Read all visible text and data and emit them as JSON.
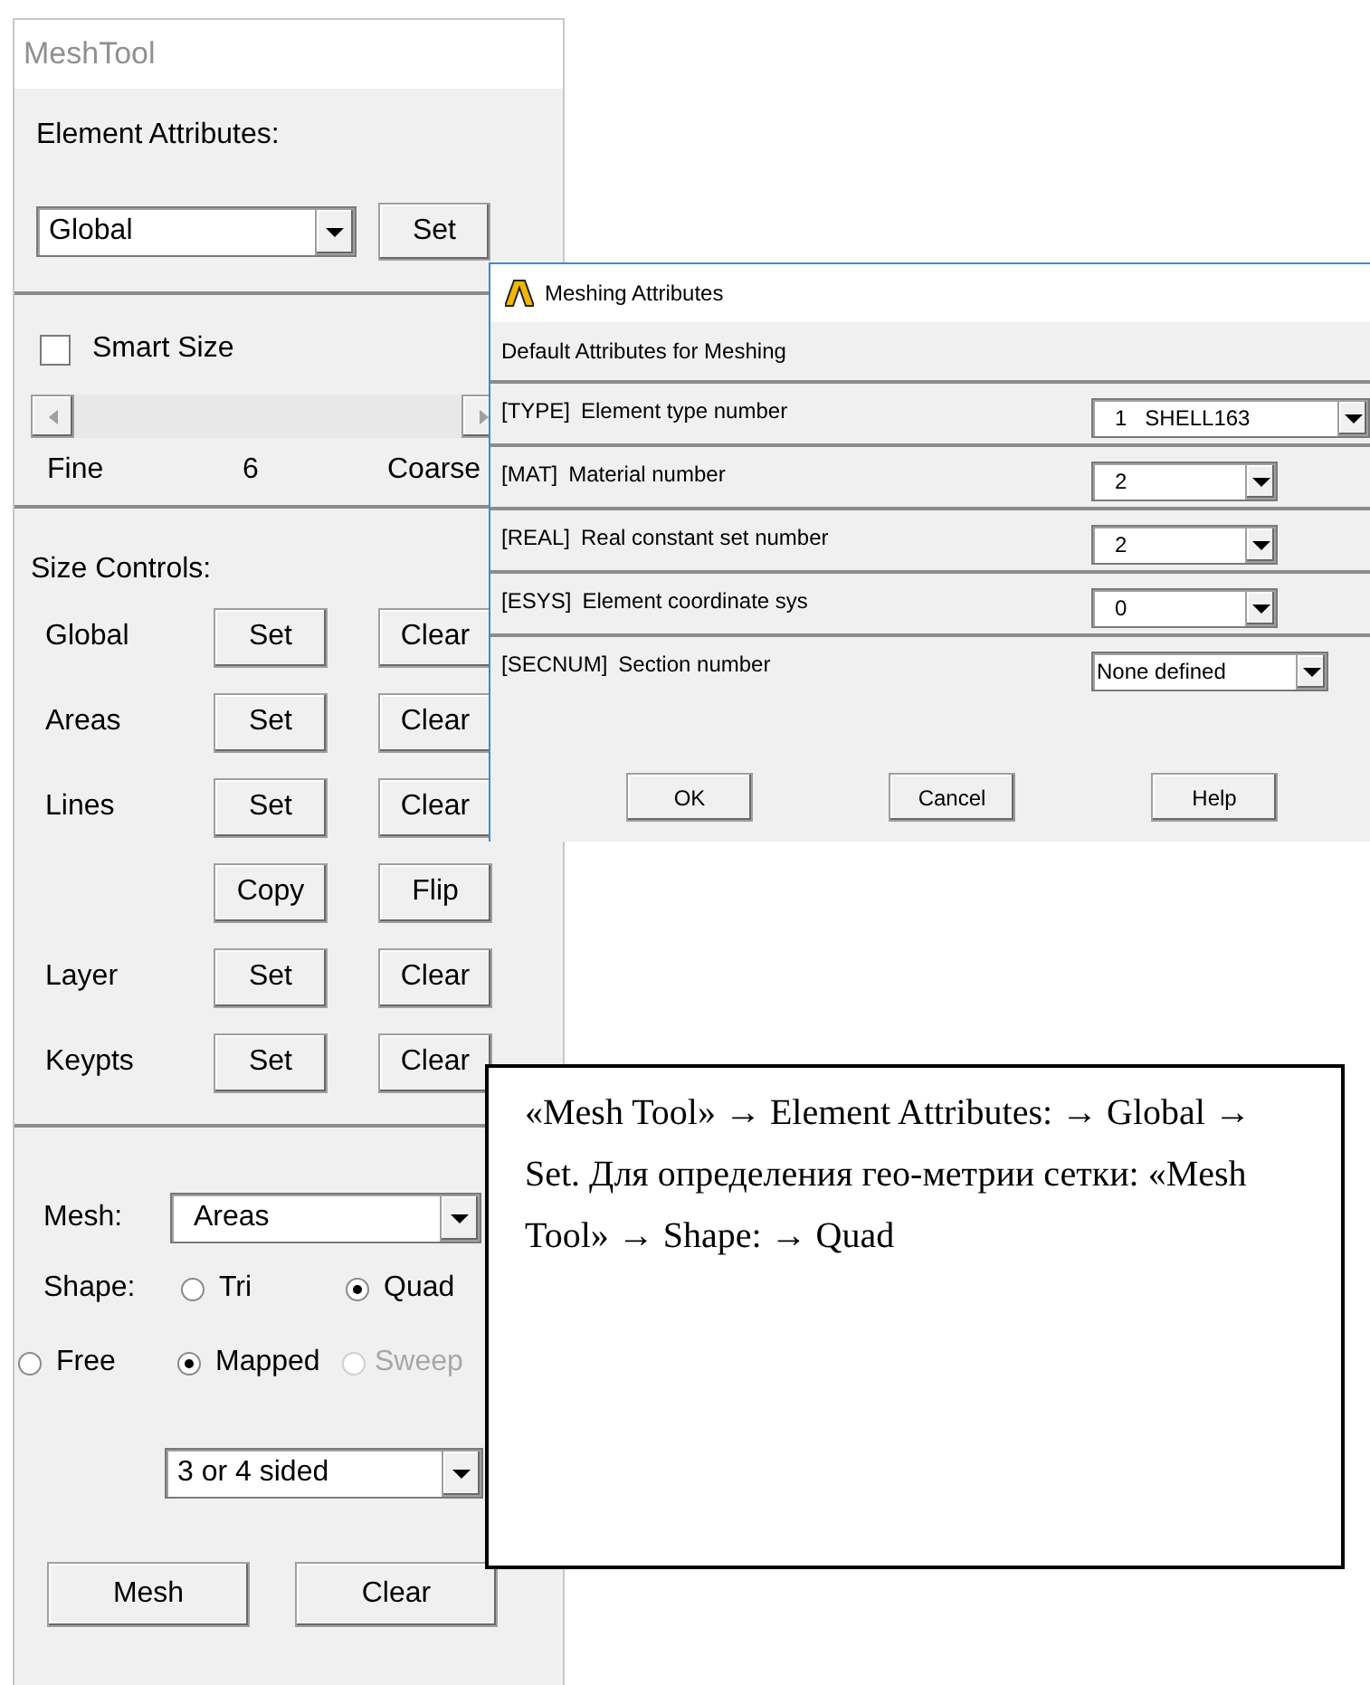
{
  "mesh_tool": {
    "title": "MeshTool",
    "element_attributes": {
      "label": "Element Attributes:",
      "dropdown": "Global",
      "button": "Set"
    },
    "smart_size": {
      "label": "Smart Size",
      "checked": false
    },
    "slider_labels": [
      "Fine",
      "6",
      "Coarse"
    ],
    "size_controls": {
      "label": "Size Controls:",
      "rows": [
        {
          "label": "Global",
          "buttons": [
            "Set",
            "Clear"
          ]
        },
        {
          "label": "Areas",
          "buttons": [
            "Set",
            "Clear"
          ]
        },
        {
          "label": "Lines",
          "buttons": [
            "Set",
            "Clear"
          ]
        },
        {
          "buttons": [
            "Copy",
            "Flip"
          ]
        },
        {
          "label": "Layer",
          "buttons": [
            "Set",
            "Clear"
          ]
        },
        {
          "label": "Keypts",
          "buttons": [
            "Set",
            "Clear"
          ]
        }
      ]
    },
    "mesh": {
      "label": "Mesh:",
      "value": "Areas"
    },
    "shape": {
      "label": "Shape:",
      "options": [
        {
          "label": "Tri",
          "selected": false
        },
        {
          "label": "Quad",
          "selected": true
        }
      ]
    },
    "method": {
      "options": [
        {
          "label": "Free",
          "selected": false,
          "disabled": false
        },
        {
          "label": "Mapped",
          "selected": true,
          "disabled": false
        },
        {
          "label": "Sweep",
          "selected": false,
          "disabled": true
        }
      ]
    },
    "sides": "3 or 4 sided",
    "buttons": [
      "Mesh",
      "Clear"
    ]
  },
  "dialog": {
    "title": "Meshing Attributes",
    "heading": "Default Attributes for Meshing",
    "fields": [
      {
        "code": "[TYPE]",
        "label": "Element type number",
        "value": "1   SHELL163",
        "kind": "wide"
      },
      {
        "code": "[MAT]",
        "label": "Material number",
        "value": "2",
        "kind": "narrow"
      },
      {
        "code": "[REAL]",
        "label": "Real constant set number",
        "value": "2",
        "kind": "narrow"
      },
      {
        "code": "[ESYS]",
        "label": "Element coordinate sys",
        "value": "0",
        "kind": "narrow"
      },
      {
        "code": "[SECNUM]",
        "label": "Section number",
        "value": "None defined",
        "kind": "medium"
      }
    ],
    "buttons": [
      "OK",
      "Cancel",
      "Help"
    ]
  },
  "note": {
    "text": "«Mesh Tool» → Element Attributes: → Global → Set. Для определения гео-метрии сетки: «Mesh Tool» → Shape: → Quad"
  }
}
